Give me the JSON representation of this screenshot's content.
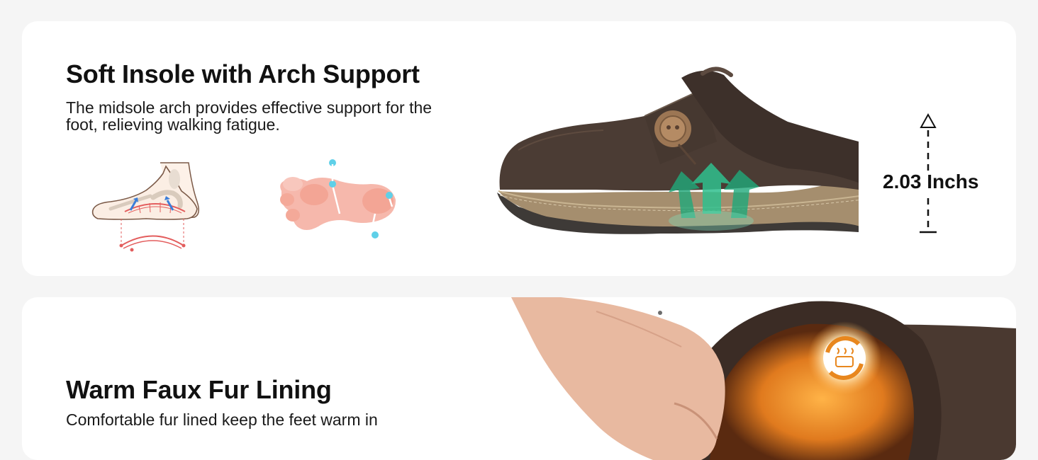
{
  "features": [
    {
      "title": "Soft Insole with Arch Support",
      "description": "The midsole arch provides effective support for the foot, relieving walking fatigue.",
      "measurement": "2.03 Inchs"
    },
    {
      "title": "Warm Faux Fur Lining",
      "description": "Comfortable fur lined keep the feet warm in"
    }
  ],
  "colors": {
    "page_background": "#f5f5f5",
    "card_background": "#ffffff",
    "text": "#111111",
    "shoe_brown": "#4a3b33",
    "sole_cork": "#a08a6a",
    "arrow_green": "#2fbf8e",
    "accent_cyan": "#5fd0e8",
    "skin_pink": "#f6b3a8"
  },
  "icons": [
    "foot-arch-icon",
    "foot-pressure-icon",
    "height-arrow-icon",
    "heat-cycle-icon"
  ]
}
